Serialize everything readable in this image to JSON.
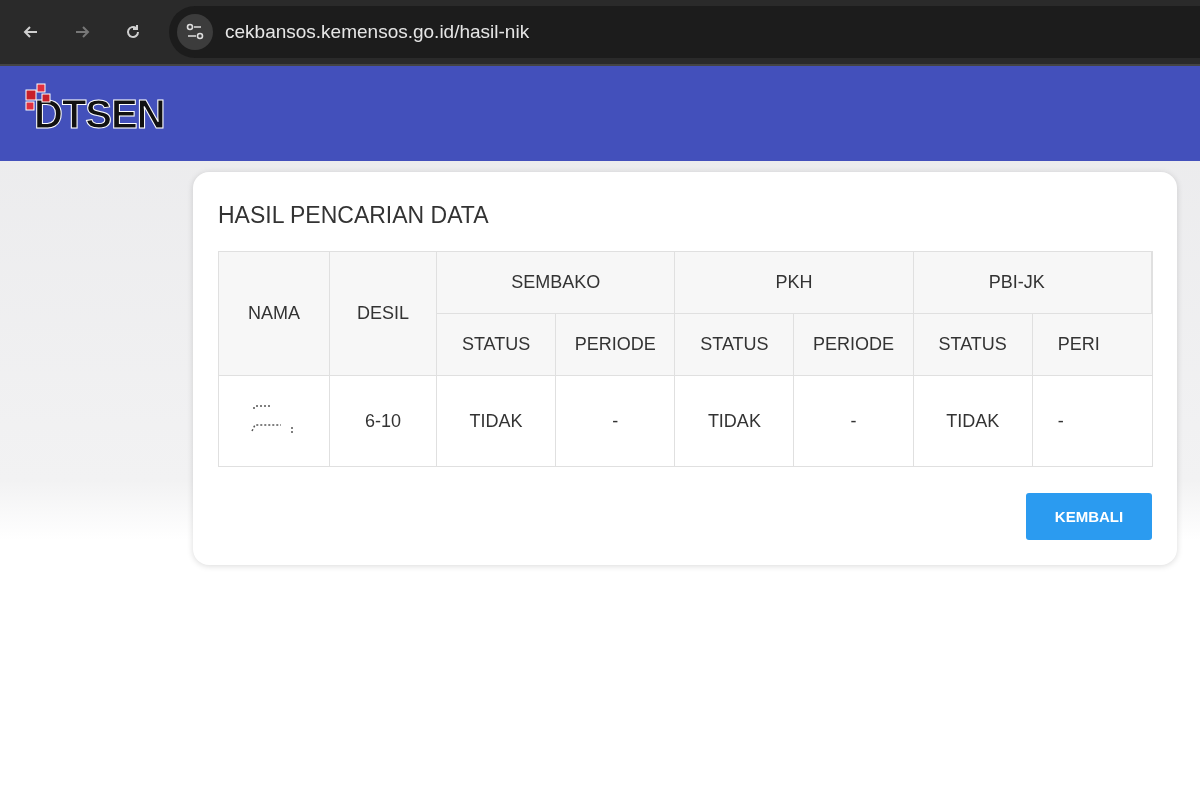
{
  "browser": {
    "url": "cekbansos.kemensos.go.id/hasil-nik"
  },
  "header": {
    "logo_text": "DTSEN"
  },
  "card": {
    "title": "HASIL PENCARIAN DATA",
    "table": {
      "columns": [
        {
          "label": "NAMA"
        },
        {
          "label": "DESIL"
        }
      ],
      "groups": [
        {
          "label": "SEMBAKO",
          "subcolumns": [
            "STATUS",
            "PERIODE"
          ]
        },
        {
          "label": "PKH",
          "subcolumns": [
            "STATUS",
            "PERIODE"
          ]
        },
        {
          "label": "PBI-JK",
          "subcolumns": [
            "STATUS",
            "PERI"
          ]
        }
      ],
      "rows": [
        {
          "desil": "6-10",
          "cells": [
            "TIDAK",
            "-",
            "TIDAK",
            "-",
            "TIDAK",
            "-"
          ]
        }
      ]
    },
    "button": "KEMBALI"
  }
}
